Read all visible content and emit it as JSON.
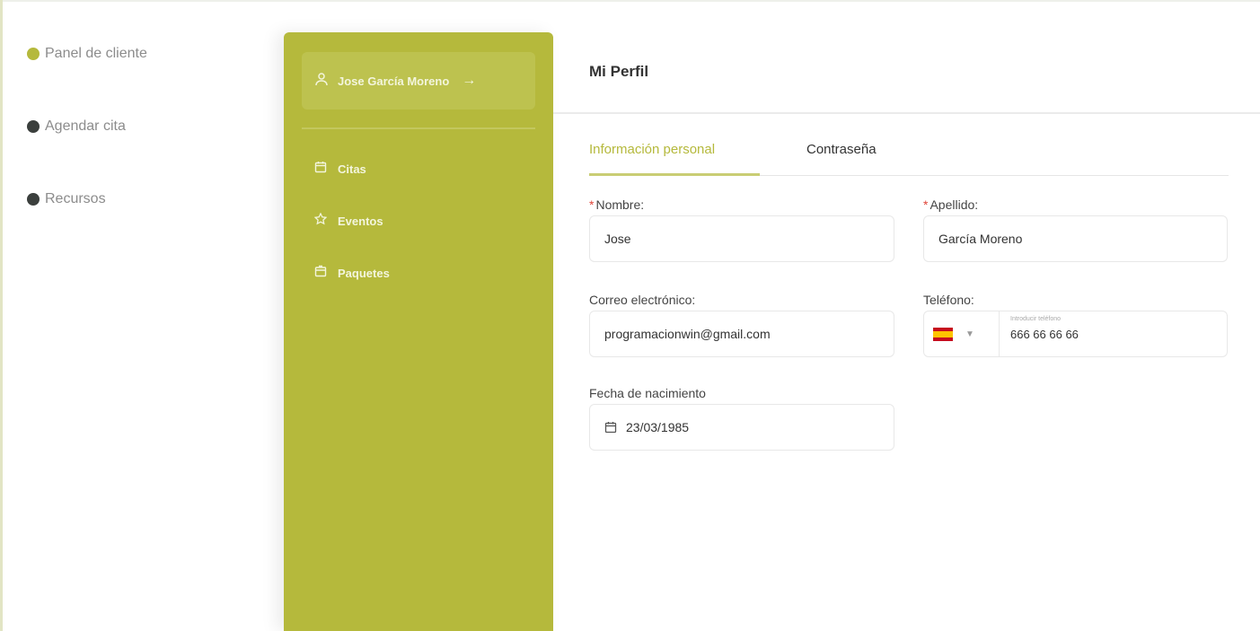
{
  "main_nav": {
    "items": [
      {
        "label": "Panel de cliente",
        "dot_color": "#b5b93c"
      },
      {
        "label": "Agendar cita",
        "dot_color": "#3b3f3d"
      },
      {
        "label": "Recursos",
        "dot_color": "#3b3f3d"
      }
    ]
  },
  "side_panel": {
    "user_name": "Jose García Moreno",
    "menu": [
      {
        "label": "Citas",
        "icon": "calendar-icon"
      },
      {
        "label": "Eventos",
        "icon": "star-icon"
      },
      {
        "label": "Paquetes",
        "icon": "package-icon"
      }
    ],
    "background_color": "#b5b93c"
  },
  "header": {
    "title": "Mi Perfil"
  },
  "tabs": [
    {
      "label": "Información personal",
      "active": true
    },
    {
      "label": "Contraseña",
      "active": false
    }
  ],
  "form": {
    "nombre": {
      "label": "Nombre:",
      "required_mark": "*",
      "value": "Jose"
    },
    "apellido": {
      "label": "Apellido:",
      "required_mark": "*",
      "value": "García Moreno"
    },
    "correo": {
      "label": "Correo electrónico:",
      "value": "programacionwin@gmail.com"
    },
    "telefono": {
      "label": "Teléfono:",
      "hint": "Introducir teléfono",
      "value": "666 66 66 66",
      "country": "ES"
    },
    "fecha": {
      "label": "Fecha de nacimiento",
      "value": "23/03/1985"
    }
  }
}
